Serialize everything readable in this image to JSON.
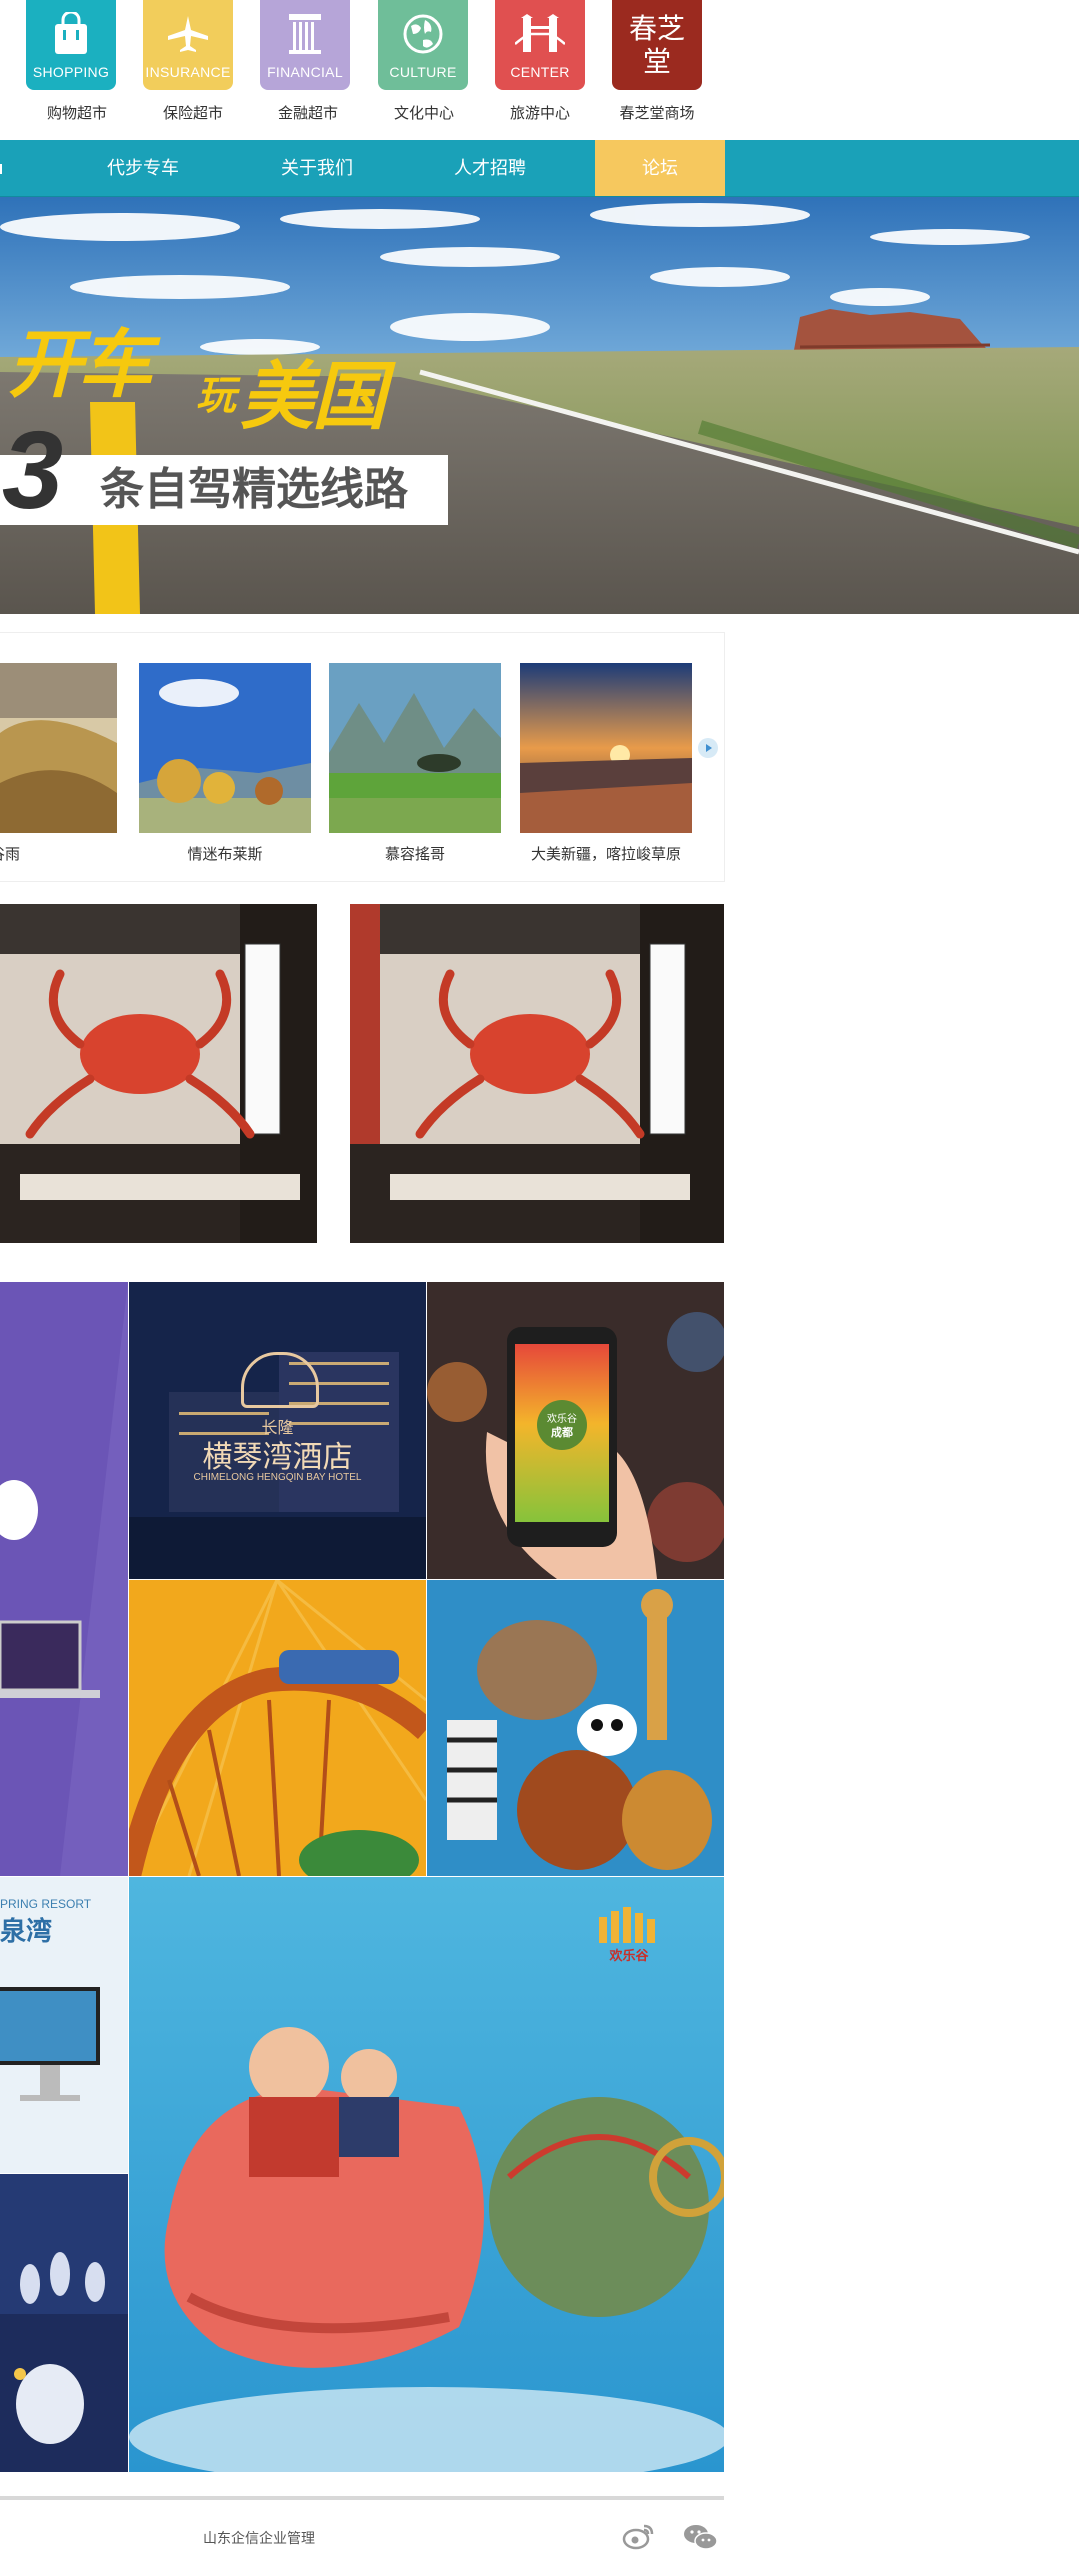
{
  "top_icons": [
    {
      "id": "shopping",
      "caption": "SHOPPING",
      "label": "购物超市",
      "color": "#1bb0c0"
    },
    {
      "id": "insurance",
      "caption": "INSURANCE",
      "label": "保险超市",
      "color": "#f2cd5b"
    },
    {
      "id": "financial",
      "caption": "FINANCIAL",
      "label": "金融超市",
      "color": "#b6a5d8"
    },
    {
      "id": "culture",
      "caption": "CULTURE",
      "label": "文化中心",
      "color": "#6fbe99"
    },
    {
      "id": "center",
      "caption": "CENTER",
      "label": "旅游中心",
      "color": "#e05050"
    },
    {
      "id": "chunzhitang",
      "caption": "春芝堂",
      "label": "春芝堂商场",
      "color": "#9b2a1f"
    }
  ],
  "nav": {
    "items": [
      {
        "label": "代步专车"
      },
      {
        "label": "关于我们"
      },
      {
        "label": "人才招聘"
      },
      {
        "label": "论坛"
      }
    ],
    "active_color": "#f6c85e",
    "bar_color": "#1aa1b8"
  },
  "hero": {
    "title_line1": "开车",
    "title_small": "玩",
    "title_line2": "美国",
    "number": "3",
    "subtitle": "条自驾精选线路"
  },
  "thumbs": [
    {
      "caption": "谷雨"
    },
    {
      "caption": "情迷布莱斯"
    },
    {
      "caption": "慕容搖哥"
    },
    {
      "caption": "大美新疆，喀拉峻草原"
    }
  ],
  "hotel": {
    "brand": "长隆",
    "name": "横琴湾酒店",
    "name_en": "CHIMELONG HENGQIN BAY HOTEL"
  },
  "phone_screen": {
    "line1": "欢乐谷",
    "line2": "成都"
  },
  "resort": {
    "en": "PRING RESORT",
    "cn": "泉湾"
  },
  "poster_logo": "欢乐谷",
  "footer": {
    "text": "山东企信企业管理"
  }
}
